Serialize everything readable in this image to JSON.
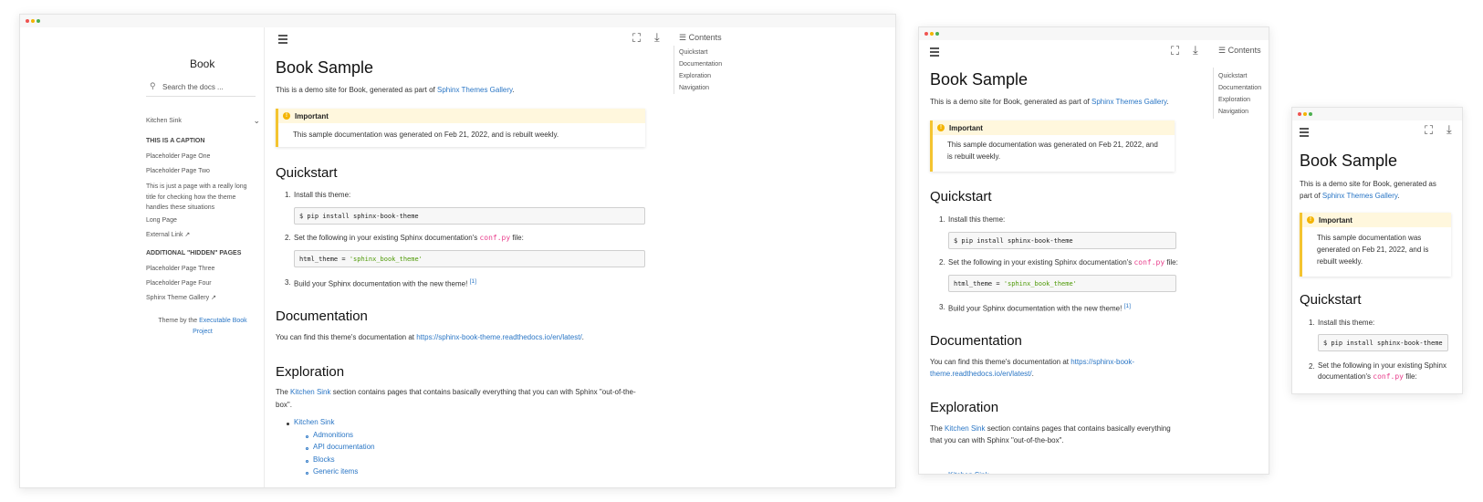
{
  "book": {
    "site_title": "Book",
    "search_placeholder": "Search the docs ...",
    "nav_top": "Kitchen Sink",
    "caption_1": "THIS IS A CAPTION",
    "nav_items_1": [
      "Placeholder Page One",
      "Placeholder Page Two"
    ],
    "long_item_lines": [
      "This is just a page with a really long",
      "title for checking how the theme",
      "handles these situations"
    ],
    "nav_items_1b": [
      "Long Page",
      "External Link"
    ],
    "caption_2": "ADDITIONAL \"HIDDEN\" PAGES",
    "nav_items_2": [
      "Placeholder Page Three",
      "Placeholder Page Four",
      "Sphinx Theme Gallery"
    ],
    "footer_prefix": "Theme by the",
    "footer_link_1": "Executable Book",
    "footer_link_2": "Project"
  },
  "toc": {
    "title": "Contents",
    "items": [
      "Quickstart",
      "Documentation",
      "Exploration",
      "Navigation"
    ]
  },
  "content": {
    "title": "Book Sample",
    "intro_prefix": "This is a demo site for Book, generated as part of",
    "intro_link": "Sphinx Themes Gallery",
    "admon_title": "Important",
    "admon_text": "This sample documentation was generated on Feb 21, 2022, and is rebuilt weekly.",
    "admon_text_w2": [
      "This sample documentation was generated on Feb 21, 2022, and",
      "is rebuilt weekly."
    ],
    "admon_text_w3": [
      "This sample documentation was",
      "generated on Feb 21, 2022, and is",
      "rebuilt weekly."
    ],
    "quickstart": "Quickstart",
    "step1": "Install this theme:",
    "code1": "$ pip install sphinx-book-theme",
    "step2_prefix": "Set the following in your existing Sphinx documentation's",
    "step2_code": "conf.py",
    "step2_suffix": "file:",
    "step2_w3": [
      "Set the following in your existing Sphinx",
      "documentation's"
    ],
    "code2_key": "html_theme",
    "code2_eq": " = ",
    "code2_val": "'sphinx_book_theme'",
    "step3": "Build your Sphinx documentation with the new theme!",
    "step3_ref": "[1]",
    "documentation": "Documentation",
    "doc_prefix": "You can find this theme's documentation at",
    "doc_link": "https://sphinx-book-theme.readthedocs.io/en/latest/",
    "doc_link_w2": [
      "https://sphinx-book-",
      "theme.readthedocs.io/en/latest/"
    ],
    "exploration": "Exploration",
    "expl_prefix": "The",
    "expl_link": "Kitchen Sink",
    "expl_suffix": "section contains pages that contains basically everything that you can with Sphinx \"out-of-the-",
    "expl_suffix2": "box\".",
    "expl_w2_line1": "section contains pages that contains basically everything",
    "expl_w2_line2": "that you can with Sphinx \"out-of-the-box\".",
    "list_top": "Kitchen Sink",
    "list_sub": [
      "Admonitions",
      "API documentation",
      "Blocks",
      "Generic items"
    ],
    "intro_w3": [
      "This is a demo site for Book, generated as",
      "part of"
    ]
  }
}
